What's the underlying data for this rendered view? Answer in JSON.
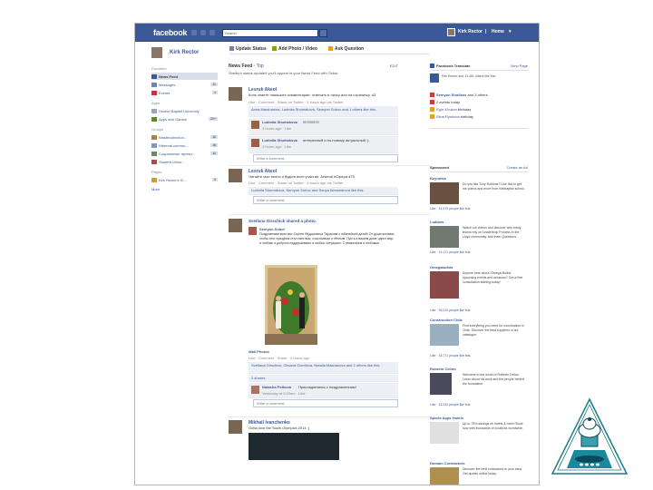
{
  "header": {
    "logo": "facebook",
    "search_placeholder": "Search",
    "user_name": "Kirk Rector",
    "home_link": "Home",
    "separator": "|"
  },
  "composer": {
    "tabs": [
      "Update Status",
      "Add Photo / Video",
      "Ask Question"
    ]
  },
  "sidebar": {
    "user_name": "Kirk Rector",
    "favorites_label": "Favorites",
    "favorites": [
      {
        "label": "News Feed",
        "count": ""
      },
      {
        "label": "Messages",
        "count": "11"
      },
      {
        "label": "Events",
        "count": "1"
      }
    ],
    "apps_label": "Apps",
    "apps": [
      {
        "label": "Huston Baptist University",
        "count": ""
      },
      {
        "label": "Apps and Games",
        "count": "20+"
      }
    ],
    "groups_label": "Groups",
    "groups": [
      {
        "label": "Wastecollection...",
        "count": "10"
      },
      {
        "label": "Hibernal commu...",
        "count": "16"
      },
      {
        "label": "Социальные проект...",
        "count": "11"
      },
      {
        "label": "Student Union...",
        "count": ""
      }
    ],
    "pages_label": "Pages",
    "pages": [
      {
        "label": "Kirk Rector's IC...",
        "count": "2"
      }
    ],
    "more_label": "More"
  },
  "feed": {
    "title": "News Feed",
    "title_suffix": "Top",
    "subtitle": "Shelby's status updated you'll appear in your News Feed with Ticker.",
    "edit_label": "EDIT",
    "posts": [
      {
        "author": "Lesruk Akeol",
        "text": "Коль знаете напишите комментарии, отвечать в личку или на страничку. #3",
        "meta": "Like · Comment · Share on Twitter · 5 hours ago via Twitter",
        "likes": "Anna Marshanina, Ludmila Shumakova, Semyon Sobov and 1 others like this.",
        "comments": [
          {
            "author": "Ludmila Shumakova",
            "text": "!!!!!!!!!!!!!!!!",
            "meta": "4 hours ago · Like"
          },
          {
            "author": "Ludmila Shumakova",
            "text": "интересный и по-новому актуальный :)",
            "meta": "4 hours ago · Like"
          }
        ],
        "comment_placeholder": "Write a comment..."
      },
      {
        "author": "Lesruk Akeol",
        "text": "Читайте мои твиты и будьте всех участия. Arsenal #Сфера #75",
        "meta": "Like · Comment · Share on Twitter · 5 hours ago via Twitter",
        "likes": "Ludmila Shumakova, Semyon Sobov and Sonya Alesandrova like this.",
        "comment_placeholder": "Write a comment..."
      },
      {
        "author": "Svetlana Girschick",
        "header_text": "Svetlana Girschick shared a photo.",
        "shared_from": "Semyon Sobol",
        "text": "Поздравляем всех вас Сергея Фёдоровича Тарасова с юбилейной датой! От души желаем, чтобы этот праздник стал светлым, счастливым и тёплым. Пусть в вашем доме царит мир, а любовь и доброта поддерживают в любых ситуациях. С уважением и любовью.",
        "album": "Wall Photos",
        "meta": "Like · Comment · Share · 4 hours ago",
        "likes": "Svetlana Girschick, Oksana Gavrilova, Natalia Makhanova and 2 others like this.",
        "shares": "2 shares",
        "comment_author": "Natasha Petkova",
        "comment_text": "Присоединяюсь к поздравлениям!",
        "comment_meta": "Yesterday at 9:29am · Like",
        "comment_placeholder": "Write a comment..."
      },
      {
        "author": "Mikhail Ivanchenko",
        "text": "Gotta love the Sochi Olympics 2014 :)"
      }
    ]
  },
  "right": {
    "translate_title": "Facebook Translate",
    "translate_more": "View Page",
    "translate_text": "Kirk Rector and 13,481 others like this.",
    "events": [
      {
        "title": "Semyon Sholikov",
        "text": "and 3 others"
      },
      {
        "title": "2 events today",
        "text": ""
      },
      {
        "title": "Egor Khukov",
        "text": "birthday"
      },
      {
        "title": "Elina Rynkova",
        "text": "birthday"
      }
    ],
    "sponsored_label": "Sponsored",
    "create_ad": "Create an Ad",
    "ads": [
      {
        "title": "Keynotes",
        "text": "Do you like Tony Robbins? Like this to get his videos and more from Kirkbaptist school.",
        "like": "Like · 14,579 people like this."
      },
      {
        "title": "Ludians",
        "text": "Watch our videos and discover why many teams rely on Leadership Process in the Lloyd community. Ask them Questions.",
        "like": "Like · 19,121 people like this."
      },
      {
        "title": "Omegabuilds",
        "text": "Anyone hear about 'Omega Builds' upcoming events and sessions? Get a free consultation starting today!",
        "like": "Like · 35,210 people like this."
      },
      {
        "title": "Construction Chile",
        "text": "Find everything you need for construction in Chile. Discover the best suppliers in our catalogue.",
        "like": "Like · 18,771 people like this."
      },
      {
        "title": "Roberto Celino",
        "text": "Welcome to the world of Roberto Celino. Learn about his work and the people behind the foundation.",
        "like": "Like · 12,331 people like this."
      },
      {
        "title": "Sports Apps Hotels",
        "text": "Up to 75% savings on hotels & more! Book now with thousands of locations worldwide.",
        "like": ""
      },
      {
        "title": "Domain Contractors",
        "text": "Discover the best contractors in your area. Get quotes online today.",
        "like": ""
      }
    ]
  },
  "colors": {
    "brand_blue": "#3b5998",
    "link_blue": "#3b5998",
    "highlight": "#d8dfea"
  },
  "decor": {
    "logo": "Baptist lighthouse emblem"
  }
}
